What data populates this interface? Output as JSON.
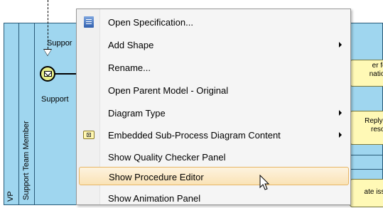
{
  "diagram": {
    "pool_label": "VP",
    "lane_label": "Support Team Member",
    "flow_label": "Suppor",
    "event_label": "Support",
    "tasks": [
      {
        "text_line1": "er for",
        "text_line2": "nation"
      },
      {
        "text_line1": "Reply u",
        "text_line2": "resou"
      },
      {
        "text_line1": "ate issu",
        "text_line2": ""
      }
    ]
  },
  "context_menu": {
    "items": [
      {
        "label": "Open Specification...",
        "icon": "specification-icon",
        "submenu": false
      },
      {
        "label": "Add Shape",
        "icon": "",
        "submenu": true
      },
      {
        "label": "Rename...",
        "icon": "",
        "submenu": false
      },
      {
        "label": "Open Parent Model - Original",
        "icon": "",
        "submenu": false
      },
      {
        "label": "Diagram Type",
        "icon": "",
        "submenu": true
      },
      {
        "label": "Embedded Sub-Process Diagram Content",
        "icon": "embedded-subprocess-icon",
        "submenu": true
      },
      {
        "label": "Show Quality Checker Panel",
        "icon": "",
        "submenu": false
      },
      {
        "label": "Show Procedure Editor",
        "icon": "",
        "submenu": false,
        "highlighted": true
      },
      {
        "label": "Show Animation Panel",
        "icon": "",
        "submenu": false
      }
    ]
  },
  "colors": {
    "pool_fill": "#9fd6ef",
    "task_fill": "#fff9b6",
    "menu_bg": "#f5f5f5",
    "highlight_border": "#e6b565"
  }
}
